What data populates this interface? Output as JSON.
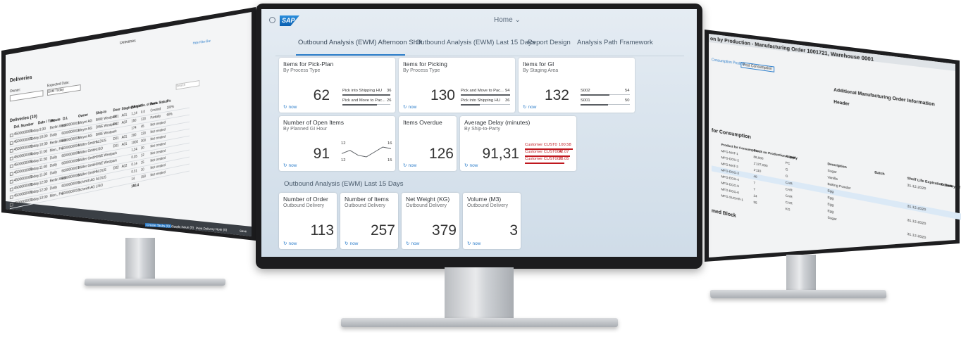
{
  "left_screen": {
    "title": "Deliveries",
    "header_link": "Hide Filter Bar",
    "header_link2": "Filt",
    "page_title": "Deliveries",
    "owner_label": "Owner:",
    "expected_date_label": "Expected Date:",
    "expected_date_value": "Until Today",
    "search_placeholder": "Search",
    "table_title": "Deliveries (10)",
    "columns": [
      "Del. Number",
      "Date / Time",
      "Route",
      "D.I.",
      "Owner",
      "Ship-to",
      "Door",
      "Staging Area",
      "Weight",
      "No. of items",
      "Pack. Status",
      "Pic"
    ],
    "rows": [
      [
        "4500000001",
        "Today",
        "9:30",
        "Berlin West",
        "6000000001",
        "Meyer AG",
        "BWE Westpark",
        "D01",
        "A01",
        "1,14",
        "0.0",
        "Created",
        "100%"
      ],
      [
        "4500000002",
        "Today",
        "10:00",
        "Daily",
        "6000000002",
        "Meyer AG",
        "DWE Westpark",
        "D02",
        "A02",
        "150",
        "120",
        "Partially",
        "60%"
      ],
      [
        "4500000003",
        "Today",
        "10:30",
        "Berlin West",
        "6000000003",
        "Meyer AG",
        "BWE Westpark",
        "",
        "",
        "174",
        "45",
        "Not created",
        ""
      ],
      [
        "4500000004",
        "Today",
        "11:00",
        "Mon., Fri.",
        "6000000004",
        "Müller GmbH",
        "ALDUS",
        "D01",
        "A01",
        "200",
        "120",
        "Not created",
        ""
      ],
      [
        "4500000005",
        "Today",
        "11:30",
        "Daily",
        "6000000005",
        "Müller GmbH",
        "LISO",
        "D01",
        "A01",
        "1000",
        "300",
        "Not created",
        ""
      ],
      [
        "4500000006",
        "Today",
        "11:30",
        "Daily",
        "6000000006",
        "Müller GmbH",
        "DWE Westpark",
        "",
        "",
        "1,24",
        "20",
        "Not created",
        ""
      ],
      [
        "4500000007",
        "Today",
        "11:30",
        "Daily",
        "6000000007",
        "Müller GmbH",
        "DWE Westpark",
        "",
        "",
        "0.35",
        "12",
        "Not created",
        ""
      ],
      [
        "4500000008",
        "Today",
        "12:00",
        "Berlin West",
        "6000000008",
        "Müller GmbH",
        "ALDUS",
        "D02",
        "A02",
        "0.14",
        "15",
        "Not created",
        ""
      ],
      [
        "4500000009",
        "Today",
        "12:30",
        "Daily",
        "6000000009",
        "Schmidt AG",
        "ALDUS",
        "",
        "",
        "0.31",
        "10",
        "Not created",
        ""
      ],
      [
        "4500000010",
        "Today",
        "13:00",
        "Mon., Fri.",
        "6000000010",
        "Schmidt AG",
        "LISO",
        "",
        "",
        "14",
        "150",
        "Not created",
        ""
      ]
    ],
    "total_label": "Total",
    "total_value": "150,4",
    "footer_buttons": [
      "Create Tasks (0)",
      "Goods Issue (0)",
      "Print Delivery Note (0)",
      "Save"
    ]
  },
  "center_screen": {
    "shell": {
      "logo_text": "SAP",
      "title": "Home",
      "title_chevron": "⌄"
    },
    "tabs": [
      "Outbound Analysis (EWM) Afternoon Shift",
      "Outbound Analysis (EWM) Last 15 Days",
      "Report Design",
      "Analysis Path Framework"
    ],
    "active_tab_index": 0,
    "accent_color": "#2f7fcb",
    "tiles_row1": [
      {
        "title": "Items for Pick-Plan",
        "subtitle": "By Process Type",
        "kpi": "62",
        "bars": [
          {
            "label": "Pick into Shipping HU",
            "value": "36",
            "fraction": 1.0
          },
          {
            "label": "Pick and Move to Pac...",
            "value": "26",
            "fraction": 0.72
          }
        ],
        "footer": "now"
      },
      {
        "title": "Items for Picking",
        "subtitle": "By Process Type",
        "kpi": "130",
        "bars": [
          {
            "label": "Pick and Move to Pac...",
            "value": "94",
            "fraction": 1.0
          },
          {
            "label": "Pick into Shipping HU",
            "value": "36",
            "fraction": 0.38
          }
        ],
        "footer": "now"
      },
      {
        "title": "Items for GI",
        "subtitle": "By Staging Area",
        "kpi": "132",
        "bars": [
          {
            "label": "S002",
            "value": "54",
            "fraction": 0.59
          },
          {
            "label": "S001",
            "value": "50",
            "fraction": 0.55
          }
        ],
        "footer": "now"
      }
    ],
    "tiles_row2": [
      {
        "title": "Number of Open Items",
        "subtitle": "By Planned GI Hour",
        "kpi": "91",
        "spark_labels": {
          "top_left": "12",
          "top_right": "16",
          "bottom_left": "12",
          "bottom_right": "15"
        },
        "spark_values": [
          12,
          14,
          11,
          10,
          13,
          16,
          15
        ],
        "footer": "now"
      },
      {
        "title": "Items Overdue",
        "subtitle": "",
        "kpi": "126",
        "footer": "now"
      },
      {
        "title": "Average Delay (minutes)",
        "subtitle": "By Ship-to-Party",
        "kpi": "91,31",
        "rows": [
          {
            "label": "Customer CUST0",
            "value": "100.58"
          },
          {
            "label": "Customer CUST004",
            "value": "92.07"
          },
          {
            "label": "Customer CUST002",
            "value": "78.05"
          }
        ],
        "status_color": "#c0181f",
        "footer": "now"
      }
    ],
    "section_title": "Outbound Analysis (EWM) Last 15 Days",
    "tiles_row3": [
      {
        "title": "Number of Order",
        "subtitle": "Outbound Delivery",
        "kpi": "113",
        "footer": "now"
      },
      {
        "title": "Number of Items",
        "subtitle": "Outbound Delivery",
        "kpi": "257",
        "footer": "now"
      },
      {
        "title": "Net Weight (KG)",
        "subtitle": "Outbound Delivery",
        "kpi": "379",
        "footer": "now"
      },
      {
        "title": "Volume (M3)",
        "subtitle": "Outbound Delivery",
        "kpi": "3",
        "footer": "now"
      }
    ]
  },
  "right_screen": {
    "title": "on by Production - Manufacturing Order 1001721, Warehouse 0001",
    "tab1": "Consumption Posting",
    "tab2": "Post Consumption",
    "panel_title": "Additional Manufacturing Order Information",
    "header_label": "Header",
    "section1": "for Consumption",
    "section2": "med Block",
    "columns": [
      "Product for Consumption",
      "Stock on Production Supply",
      "A.Unit",
      "Description",
      "Batch",
      "Shelf Life Expiration Date",
      "Country of Origin"
    ],
    "rows": [
      [
        "MFG-MAT-1",
        "88,000",
        "PC",
        "Sugar",
        "",
        "31.12.2020",
        ""
      ],
      [
        "MFG-DOU-2",
        "1'127,000",
        "G",
        "Vanilla",
        "",
        "",
        ""
      ],
      [
        "MFG-MAT-3",
        "1'110",
        "G",
        "Baking Powder",
        "",
        "",
        ""
      ],
      [
        "MFG-EGG-3",
        "40",
        "CAR",
        "Egg",
        "",
        "31.12.2020",
        ""
      ],
      [
        "MFG-EGG-4",
        "7",
        "CAR",
        "Egg",
        "",
        "",
        ""
      ],
      [
        "MFG-EGG-5",
        "7",
        "CAR",
        "Egg",
        "",
        "31.12.2020",
        ""
      ],
      [
        "MFG-EGG-6",
        "24",
        "CAR",
        "Egg",
        "",
        "",
        ""
      ],
      [
        "MFG-SUGAR-1",
        "55",
        "KG",
        "Sugar",
        "",
        "31.12.2020",
        ""
      ]
    ]
  }
}
